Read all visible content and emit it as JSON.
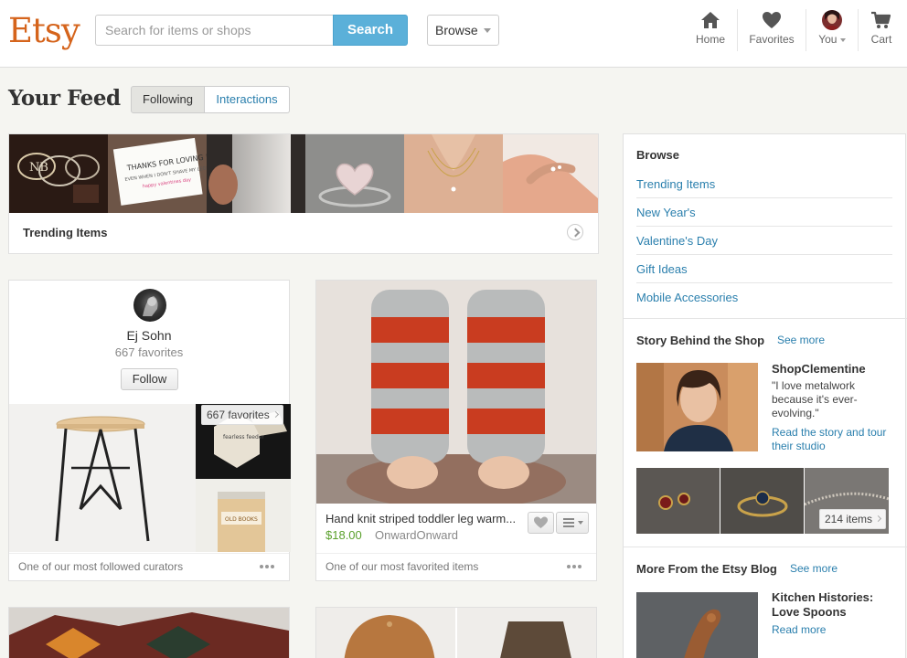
{
  "header": {
    "logo": "Etsy",
    "search_placeholder": "Search for items or shops",
    "search_button": "Search",
    "browse_button": "Browse",
    "nav": {
      "home": "Home",
      "favorites": "Favorites",
      "you": "You",
      "cart": "Cart"
    }
  },
  "feed": {
    "title": "Your Feed",
    "tabs": {
      "following": "Following",
      "interactions": "Interactions"
    },
    "trending_label": "Trending Items",
    "trending_card_text": {
      "line1": "THANKS FOR LOVING ME",
      "line2": "EVEN WHEN I DON'T SHAVE MY LEGS",
      "line3": "happy valentines day"
    }
  },
  "curator_card": {
    "name": "Ej Sohn",
    "favorites": "667 favorites",
    "follow_button": "Follow",
    "fav_badge": "667 favorites",
    "footer": "One of our most followed curators",
    "product_label_1": "fearless feeder",
    "product_label_2": "OLD BOOKS"
  },
  "item_card": {
    "title": "Hand knit striped toddler leg warm...",
    "price": "$18.00",
    "shop": "OnwardOnward",
    "footer": "One of our most favorited items"
  },
  "sidebar": {
    "browse_heading": "Browse",
    "links": [
      "Trending Items",
      "New Year's",
      "Valentine's Day",
      "Gift Ideas",
      "Mobile Accessories"
    ],
    "story_heading": "Story Behind the Shop",
    "story_see_more": "See more",
    "story_shop": "ShopClementine",
    "story_quote": "\"I love metalwork because it's ever-evolving.\"",
    "story_link": "Read the story and tour their studio",
    "items_badge": "214 items",
    "blog_heading": "More From the Etsy Blog",
    "blog_see_more": "See more",
    "blog_title": "Kitchen Histories: Love Spoons",
    "blog_link": "Read more"
  },
  "colors": {
    "brand": "#d5641c",
    "link": "#2a7fad",
    "search_button": "#5bb0d9",
    "price": "#5aa02c"
  }
}
